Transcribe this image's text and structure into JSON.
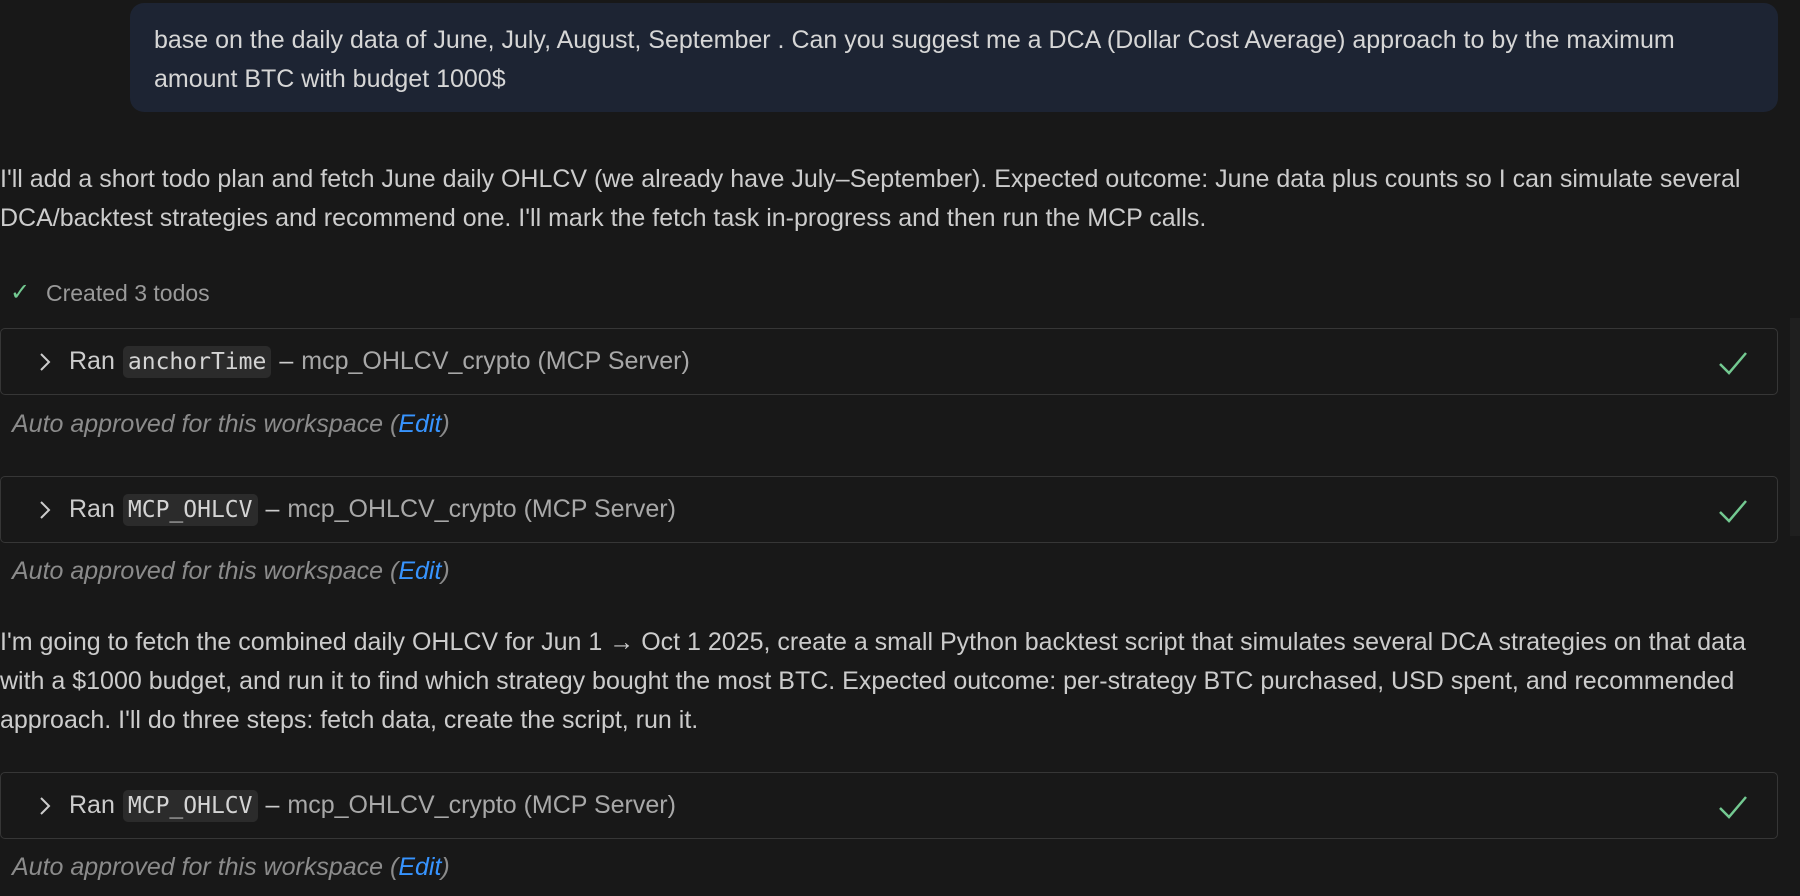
{
  "user_message": {
    "text": "base on the daily data of June, July, August, September . Can you suggest me a DCA (Dollar Cost Average) approach to by the maximum amount BTC with budget 1000$"
  },
  "assistant": {
    "intro": "I'll add a short todo plan and fetch June daily OHLCV (we already have July–September). Expected outcome: June data plus counts so I can simulate several DCA/backtest strategies and recommend one. I'll mark the fetch task in-progress and then run the MCP calls.",
    "todos_status": "Created 3 todos",
    "followup": "I'm going to fetch the combined daily OHLCV for Jun 1 → Oct 1 2025, create a small Python backtest script that simulates several DCA strategies on that data with a $1000 budget, and run it to find which strategy bought the most BTC. Expected outcome: per-strategy BTC purchased, USD spent, and recommended approach. I'll do three steps: fetch data, create the script, run it."
  },
  "tool_calls": [
    {
      "ran_label": "Ran",
      "tool": "anchorTime",
      "dash": "–",
      "server": "mcp_OHLCV_crypto (MCP Server)",
      "approval_text": "Auto approved for this workspace",
      "approval_open": "(",
      "edit_label": "Edit",
      "approval_close": ")"
    },
    {
      "ran_label": "Ran",
      "tool": "MCP_OHLCV",
      "dash": "–",
      "server": "mcp_OHLCV_crypto (MCP Server)",
      "approval_text": "Auto approved for this workspace",
      "approval_open": "(",
      "edit_label": "Edit",
      "approval_close": ")"
    },
    {
      "ran_label": "Ran",
      "tool": "MCP_OHLCV",
      "dash": "–",
      "server": "mcp_OHLCV_crypto (MCP Server)",
      "approval_text": "Auto approved for this workspace",
      "approval_open": "(",
      "edit_label": "Edit",
      "approval_close": ")"
    }
  ],
  "icons": {
    "chevron": "chevron-right-icon",
    "done": "checkmark-icon",
    "todo": "checkmark-icon"
  },
  "colors": {
    "background": "#181818",
    "user_bubble": "#1d2433",
    "success": "#73c991",
    "link": "#3794ff",
    "card_border": "#363636"
  }
}
